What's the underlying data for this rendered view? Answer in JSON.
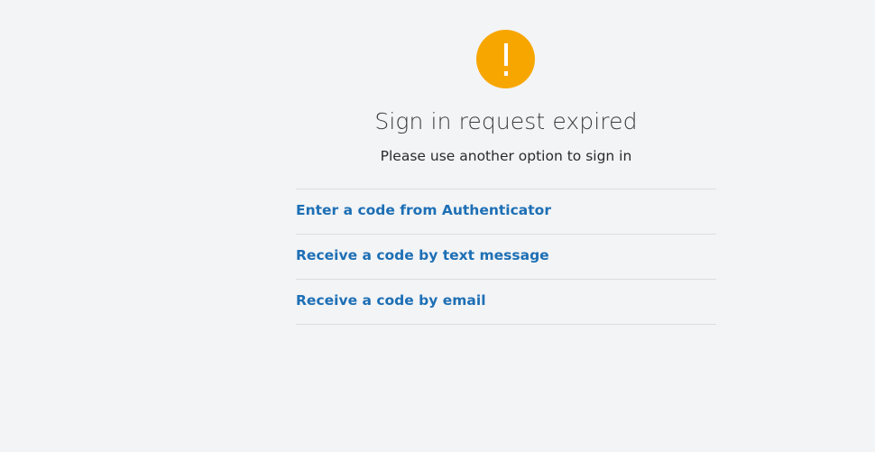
{
  "status": {
    "icon": "exclamation-warning-icon",
    "icon_color": "#f7a600",
    "title": "Sign in request expired",
    "subtitle": "Please use another option to sign in"
  },
  "options": [
    {
      "label": "Enter a code from Authenticator"
    },
    {
      "label": "Receive a code by text message"
    },
    {
      "label": "Receive a code by email"
    }
  ],
  "colors": {
    "background": "#f3f4f6",
    "link": "#1d6fb5",
    "divider": "#dcdde0"
  }
}
